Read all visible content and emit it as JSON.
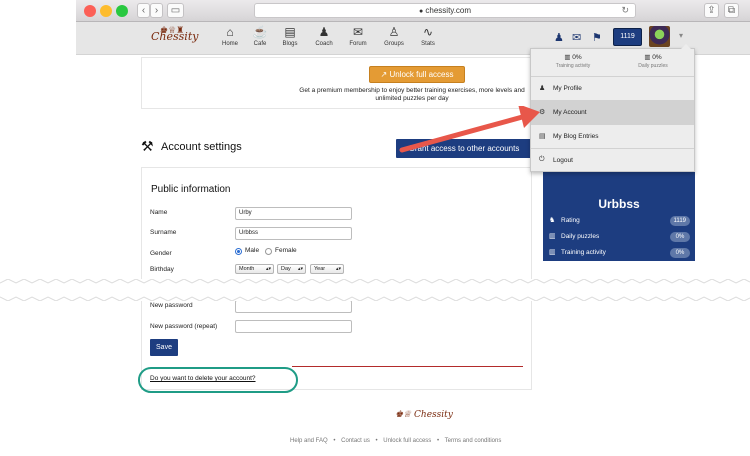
{
  "browser": {
    "url": "chessity.com",
    "back_glyph": "‹",
    "forward_glyph": "›",
    "sidebar_glyph": "▭",
    "reload_glyph": "↻",
    "share_glyph": "⇪",
    "tabs_glyph": "⧉"
  },
  "site_nav": {
    "logo": "Chessity",
    "items": [
      {
        "label": "Home",
        "icon": "home-icon",
        "glyph": "⌂"
      },
      {
        "label": "Cafe",
        "icon": "cup-icon",
        "glyph": "☕"
      },
      {
        "label": "Blogs",
        "icon": "blog-icon",
        "glyph": "▤"
      },
      {
        "label": "Coach",
        "icon": "coach-icon",
        "glyph": "♟"
      },
      {
        "label": "Forum",
        "icon": "forum-icon",
        "glyph": "✉"
      },
      {
        "label": "Groups",
        "icon": "groups-icon",
        "glyph": "♙"
      },
      {
        "label": "Stats",
        "icon": "stats-icon",
        "glyph": "∿"
      }
    ],
    "user_glyph": "♟",
    "mail_glyph": "✉",
    "flag_glyph": "⚑",
    "rating": "1119",
    "caret": "▾"
  },
  "premium": {
    "button_label": "Unlock full access",
    "button_glyph": "↗",
    "text": "Get a premium membership to enjoy better training exercises, more levels and unlimited puzzles per day"
  },
  "settings": {
    "title": "Account settings",
    "tools_glyph": "⚒",
    "grant_button": "Grant access to other accounts"
  },
  "form": {
    "section_title": "Public information",
    "name_label": "Name",
    "name_value": "Urby",
    "surname_label": "Surname",
    "surname_value": "Urbbss",
    "gender_label": "Gender",
    "gender_male": "Male",
    "gender_female": "Female",
    "birthday_label": "Birthday",
    "birthday_month": "Month",
    "birthday_day": "Day",
    "birthday_year": "Year",
    "new_password_label": "New password",
    "new_password_repeat_label": "New password (repeat)",
    "save_label": "Save",
    "delete_link": "Do you want to delete your account?",
    "select_caret": "▴▾"
  },
  "dropdown": {
    "stats": [
      {
        "value": "0%",
        "label": "Training activity"
      },
      {
        "value": "0%",
        "label": "Daily puzzles"
      }
    ],
    "stat_glyph": "▥",
    "items": [
      {
        "label": "My Profile",
        "glyph": "♟"
      },
      {
        "label": "My Account",
        "glyph": "⚙"
      },
      {
        "label": "My Blog Entries",
        "glyph": "▤"
      },
      {
        "label": "Logout",
        "glyph": "⏻"
      }
    ]
  },
  "profile": {
    "username": "Urbbss",
    "stats": [
      {
        "label": "Rating",
        "value": "1119",
        "glyph": "♞"
      },
      {
        "label": "Daily puzzles",
        "value": "0%",
        "glyph": "▥"
      },
      {
        "label": "Training activity",
        "value": "0%",
        "glyph": "▥"
      }
    ]
  },
  "footer": {
    "logo": "Chessity",
    "links": [
      "Help and FAQ",
      "Contact us",
      "Unlock full access",
      "Terms and conditions"
    ],
    "separator": "•"
  },
  "colors": {
    "brand_blue": "#1d3d80",
    "premium_orange": "#e49b34",
    "annotation_red": "#e8574a",
    "annotation_teal": "#1f9c86"
  }
}
